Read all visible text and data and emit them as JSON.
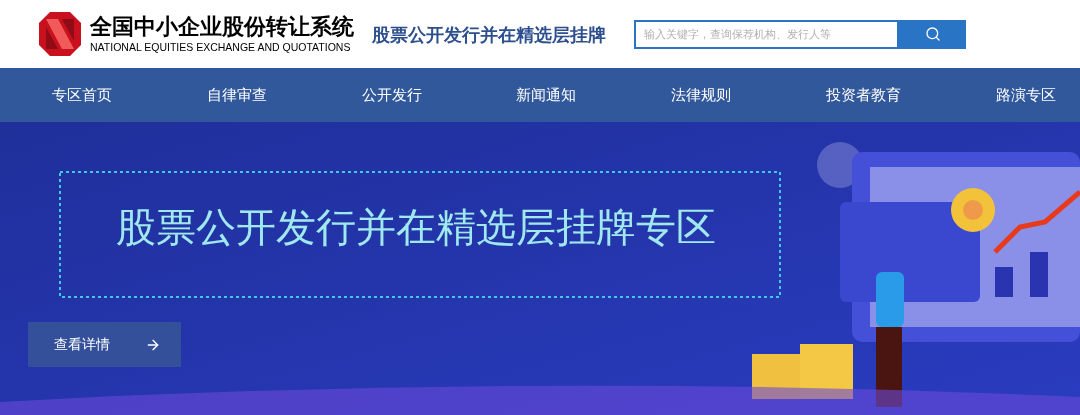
{
  "header": {
    "logo_title": "全国中小企业股份转让系统",
    "logo_subtitle": "NATIONAL EQUITIES EXCHANGE AND QUOTATIONS",
    "section_title": "股票公开发行并在精选层挂牌"
  },
  "search": {
    "placeholder": "输入关键字，查询保荐机构、发行人等"
  },
  "nav": {
    "items": [
      {
        "label": "专区首页",
        "selected": false
      },
      {
        "label": "自律审查",
        "selected": false
      },
      {
        "label": "公开发行",
        "selected": false
      },
      {
        "label": "新闻通知",
        "selected": false
      },
      {
        "label": "法律规则",
        "selected": false
      },
      {
        "label": "投资者教育",
        "selected": false
      },
      {
        "label": "路演专区",
        "selected": false
      }
    ]
  },
  "banner": {
    "kind": "picture",
    "heading": "股票公开发行并在精选层挂牌专区",
    "button": "查看详情"
  }
}
